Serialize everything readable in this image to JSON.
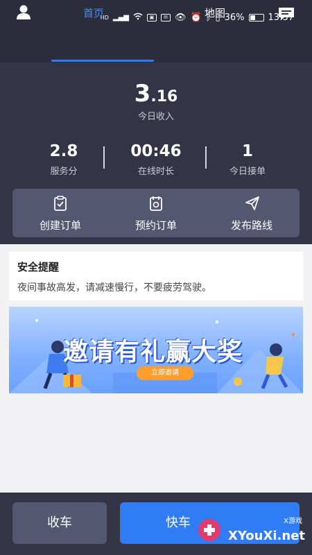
{
  "status": {
    "battery_pct": "36%",
    "time": "13:37",
    "net": "HD"
  },
  "nav": {
    "tab_home": "首页",
    "tab_map": "地图"
  },
  "income": {
    "value_main": "3",
    "value_decimal": ".16",
    "label": "今日收入"
  },
  "stats": [
    {
      "value": "2.8",
      "label": "服务分"
    },
    {
      "value": "00:46",
      "label": "在线时长"
    },
    {
      "value": "1",
      "label": "今日接单"
    }
  ],
  "actions": [
    {
      "label": "创建订单",
      "icon": "clipboard-icon"
    },
    {
      "label": "预约订单",
      "icon": "calendar-icon"
    },
    {
      "label": "发布路线",
      "icon": "send-icon"
    }
  ],
  "safety": {
    "title": "安全提醒",
    "text": "夜间事故高发，请减速慢行，不要疲劳驾驶。"
  },
  "banner": {
    "title": "邀请有礼赢大奖",
    "button": "立即邀请"
  },
  "bottom": {
    "stop_label": "收车",
    "fast_label": "快车"
  },
  "watermark": {
    "brand": "XYouXi.net",
    "small": "X游戏"
  },
  "colors": {
    "dark_bg": "#333546",
    "accent": "#2f7cf4",
    "panel": "#545770"
  }
}
